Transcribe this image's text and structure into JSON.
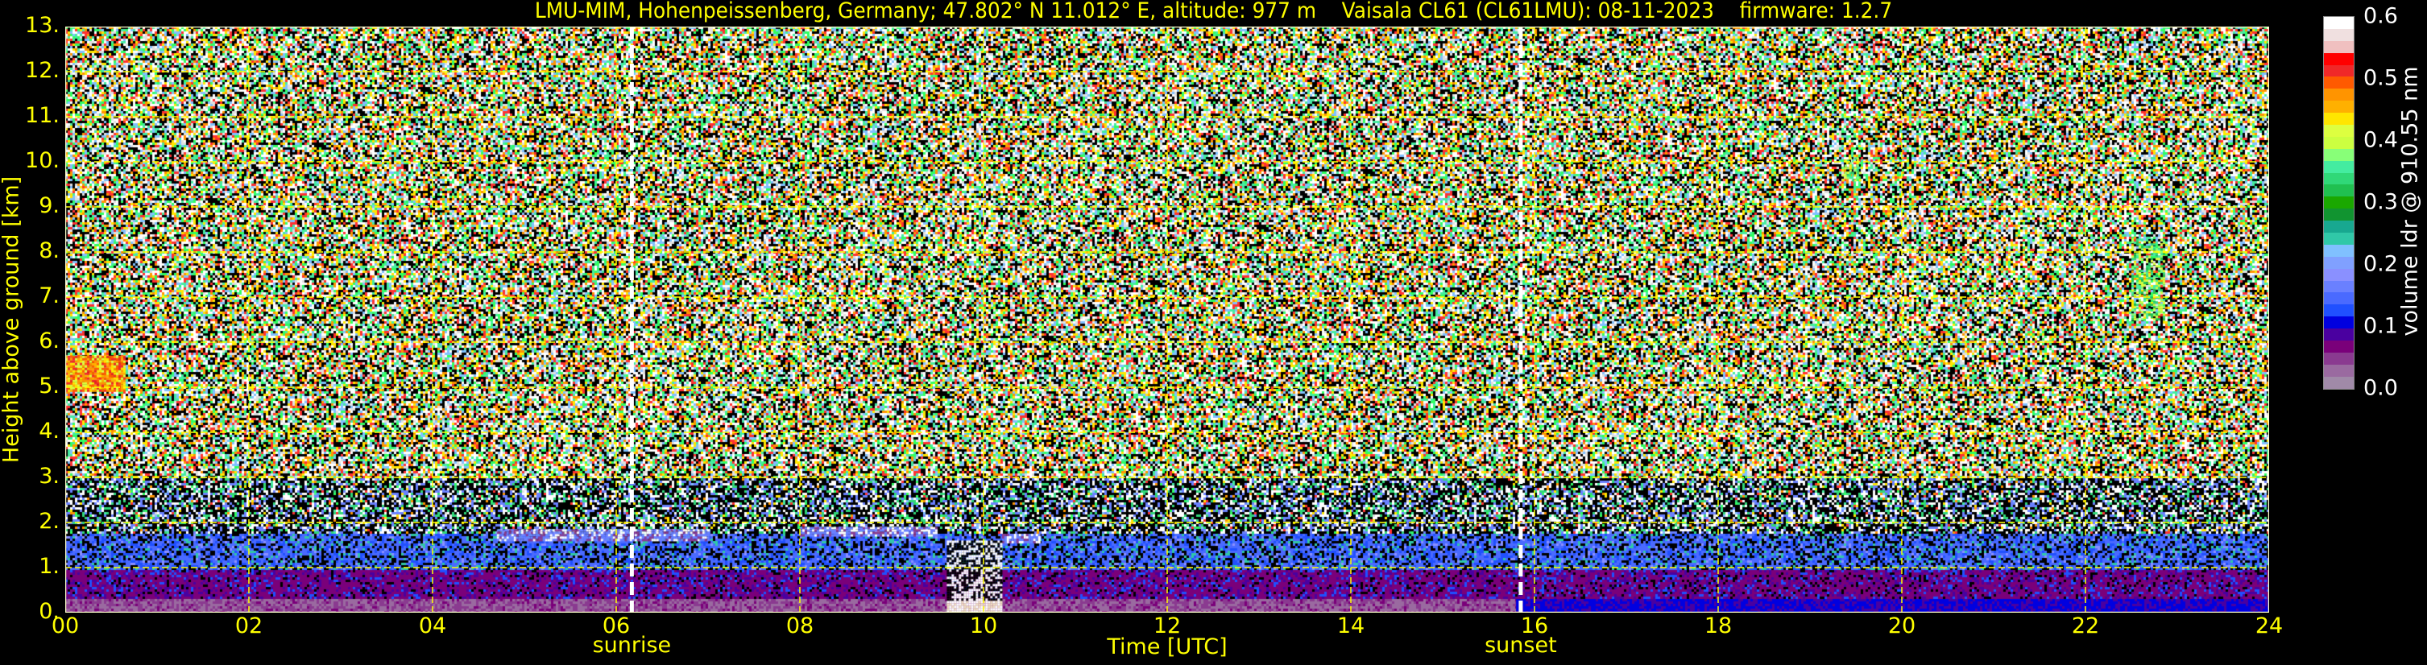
{
  "chart_data": {
    "type": "heatmap",
    "title": "LMU-MIM, Hohenpeissenberg, Germany; 47.802° N 11.012° E, altitude: 977 m    Vaisala CL61 (CL61LMU): 08-11-2023    firmware: 1.2.7",
    "xlabel": "Time [UTC]",
    "ylabel": "Height above ground [km]",
    "xlim": [
      0,
      24
    ],
    "ylim": [
      0,
      13
    ],
    "xticks": [
      "00",
      "02",
      "04",
      "06",
      "08",
      "10",
      "12",
      "14",
      "16",
      "18",
      "20",
      "22",
      "24"
    ],
    "yticks": [
      "0.",
      "1.",
      "2.",
      "3.",
      "4.",
      "5.",
      "6.",
      "7.",
      "8.",
      "9.",
      "10.",
      "11.",
      "12.",
      "13."
    ],
    "grid": true,
    "grid_color": "#ffff00",
    "events": [
      {
        "label": "sunrise",
        "time": 6.17
      },
      {
        "label": "sunset",
        "time": 15.85
      }
    ],
    "colorbar": {
      "label": "volume ldr @ 910.55 nm",
      "range": [
        0,
        0.6
      ],
      "ticks": [
        "0.0",
        "0.1",
        "0.2",
        "0.3",
        "0.4",
        "0.5",
        "0.6"
      ],
      "colors": [
        "#a08aa8",
        "#9a6aa0",
        "#8a3a90",
        "#7a007a",
        "#4a00a0",
        "#0000e0",
        "#2050ff",
        "#4a6aff",
        "#6a80ff",
        "#8a90ff",
        "#80a0ff",
        "#80c0ff",
        "#30c8a8",
        "#18a890",
        "#119430",
        "#1aa800",
        "#20c050",
        "#30d878",
        "#44eca0",
        "#88ff78",
        "#ccff40",
        "#ddff40",
        "#ffe600",
        "#ffb000",
        "#ff9400",
        "#ff5a00",
        "#f02828",
        "#ff0000",
        "#f0c0c0",
        "#f0e0e0",
        "#ffffff"
      ]
    },
    "features": [
      {
        "kind": "cloud",
        "t0": 0.0,
        "t1": 0.65,
        "h0": 4.9,
        "h1": 5.7,
        "ldr": 0.48
      },
      {
        "kind": "layer",
        "t0": 4.7,
        "t1": 7.0,
        "h0": 1.6,
        "h1": 1.85,
        "ldr": 0.08
      },
      {
        "kind": "layer",
        "t0": 8.0,
        "t1": 9.5,
        "h0": 1.7,
        "h1": 1.9,
        "ldr": 0.08
      },
      {
        "kind": "layer",
        "t0": 10.2,
        "t1": 10.6,
        "h0": 1.55,
        "h1": 1.75,
        "ldr": 0.08
      },
      {
        "kind": "gap",
        "t0": 9.6,
        "t1": 10.2,
        "h0": 0.0,
        "h1": 1.6,
        "ldr": 0.6
      },
      {
        "kind": "cirrus",
        "t0": 19.35,
        "t1": 19.55,
        "h0": 9.6,
        "h1": 10.1,
        "ldr": 0.4
      },
      {
        "kind": "cirrus",
        "t0": 22.5,
        "t1": 22.85,
        "h0": 6.5,
        "h1": 8.3,
        "ldr": 0.38
      }
    ],
    "boundary_layer_top_km": 1.8
  }
}
